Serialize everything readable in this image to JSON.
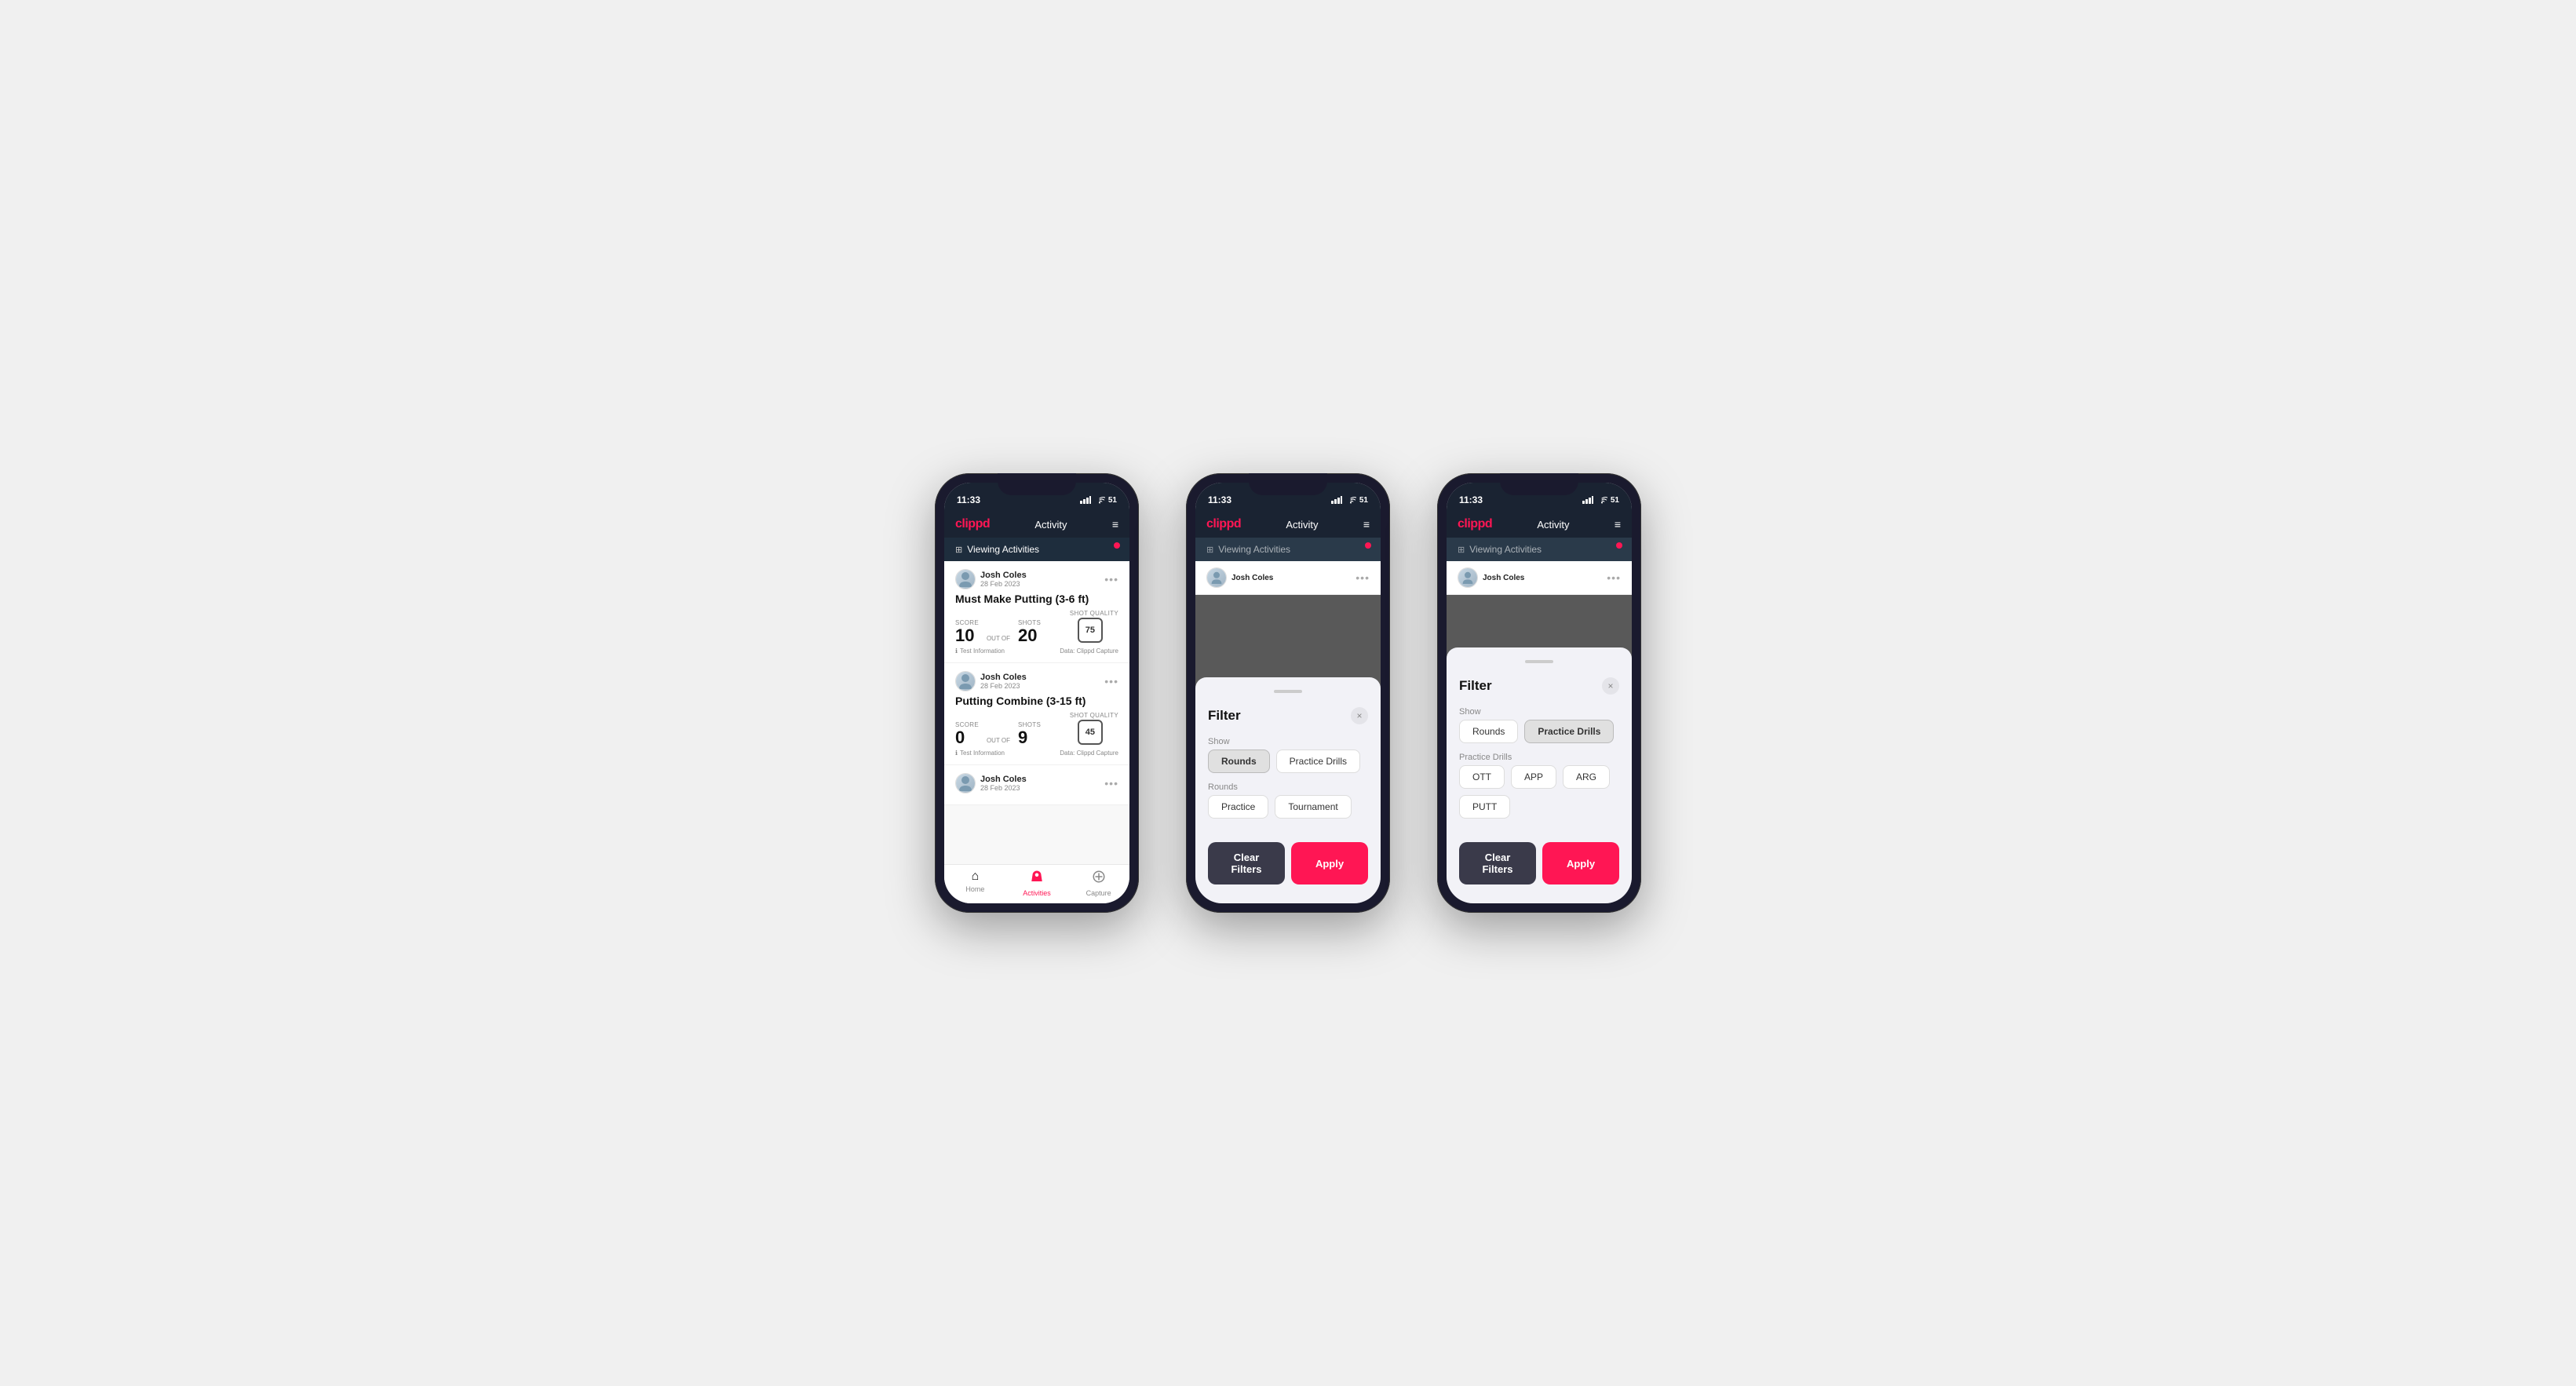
{
  "phones": [
    {
      "id": "phone1",
      "type": "activity-list",
      "statusBar": {
        "time": "11:33",
        "signal": "●●●",
        "wifi": "wifi",
        "battery": "51"
      },
      "header": {
        "logo": "clippd",
        "title": "Activity",
        "menuIcon": "≡"
      },
      "viewingBanner": {
        "icon": "⊞",
        "text": "Viewing Activities"
      },
      "cards": [
        {
          "userName": "Josh Coles",
          "userDate": "28 Feb 2023",
          "activityTitle": "Must Make Putting (3-6 ft)",
          "scoreLabel": "Score",
          "scoreValue": "10",
          "outOfLabel": "OUT OF",
          "shotsLabel": "Shots",
          "shotsValue": "20",
          "shotQualityLabel": "Shot Quality",
          "shotQualityValue": "75",
          "testInfo": "Test Information",
          "dataSource": "Data: Clippd Capture"
        },
        {
          "userName": "Josh Coles",
          "userDate": "28 Feb 2023",
          "activityTitle": "Putting Combine (3-15 ft)",
          "scoreLabel": "Score",
          "scoreValue": "0",
          "outOfLabel": "OUT OF",
          "shotsLabel": "Shots",
          "shotsValue": "9",
          "shotQualityLabel": "Shot Quality",
          "shotQualityValue": "45",
          "testInfo": "Test Information",
          "dataSource": "Data: Clippd Capture"
        },
        {
          "userName": "Josh Coles",
          "userDate": "28 Feb 2023",
          "activityTitle": "",
          "partial": true
        }
      ],
      "bottomNav": [
        {
          "icon": "⌂",
          "label": "Home",
          "active": false
        },
        {
          "icon": "♟",
          "label": "Activities",
          "active": true
        },
        {
          "icon": "⊕",
          "label": "Capture",
          "active": false
        }
      ]
    },
    {
      "id": "phone2",
      "type": "filter-rounds",
      "statusBar": {
        "time": "11:33",
        "signal": "●●●",
        "wifi": "wifi",
        "battery": "51"
      },
      "header": {
        "logo": "clippd",
        "title": "Activity",
        "menuIcon": "≡"
      },
      "viewingBanner": {
        "icon": "⊞",
        "text": "Viewing Activities"
      },
      "filter": {
        "title": "Filter",
        "closeIcon": "×",
        "showLabel": "Show",
        "showOptions": [
          {
            "label": "Rounds",
            "active": true
          },
          {
            "label": "Practice Drills",
            "active": false
          }
        ],
        "roundsLabel": "Rounds",
        "roundsOptions": [
          {
            "label": "Practice",
            "active": false
          },
          {
            "label": "Tournament",
            "active": false
          }
        ],
        "clearFiltersLabel": "Clear Filters",
        "applyLabel": "Apply"
      }
    },
    {
      "id": "phone3",
      "type": "filter-drills",
      "statusBar": {
        "time": "11:33",
        "signal": "●●●",
        "wifi": "wifi",
        "battery": "51"
      },
      "header": {
        "logo": "clippd",
        "title": "Activity",
        "menuIcon": "≡"
      },
      "viewingBanner": {
        "icon": "⊞",
        "text": "Viewing Activities"
      },
      "filter": {
        "title": "Filter",
        "closeIcon": "×",
        "showLabel": "Show",
        "showOptions": [
          {
            "label": "Rounds",
            "active": false
          },
          {
            "label": "Practice Drills",
            "active": true
          }
        ],
        "drillsLabel": "Practice Drills",
        "drillsOptions": [
          {
            "label": "OTT",
            "active": false
          },
          {
            "label": "APP",
            "active": false
          },
          {
            "label": "ARG",
            "active": false
          },
          {
            "label": "PUTT",
            "active": false
          }
        ],
        "clearFiltersLabel": "Clear Filters",
        "applyLabel": "Apply"
      }
    }
  ]
}
